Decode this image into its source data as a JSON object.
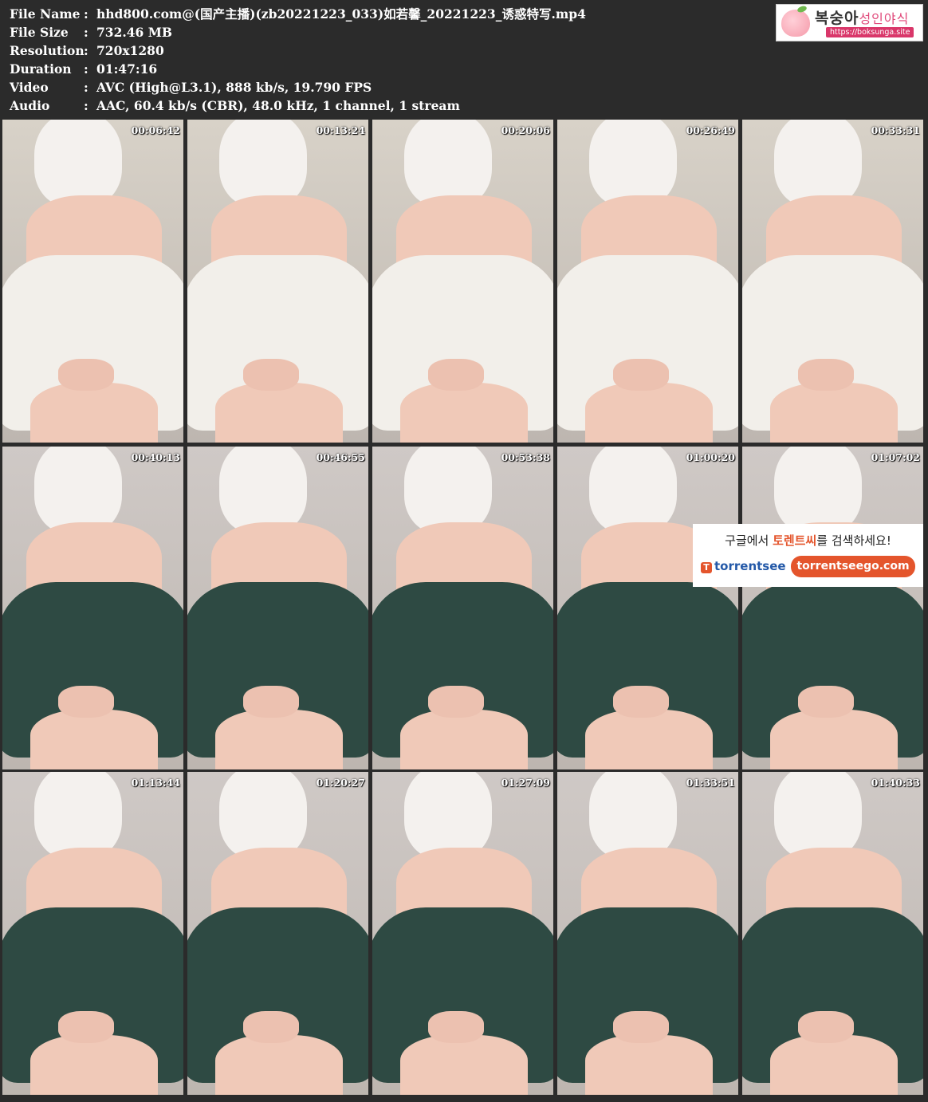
{
  "info": {
    "rows": [
      {
        "key": "File Name",
        "colon": ":",
        "value": "hhd800.com@(国产主播)(zb20221223_033)如若馨_20221223_诱惑特写.mp4"
      },
      {
        "key": "File Size",
        "colon": ":",
        "value": "732.46 MB"
      },
      {
        "key": "Resolution",
        "colon": ":",
        "value": "720x1280"
      },
      {
        "key": "Duration",
        "colon": ":",
        "value": "01:47:16"
      },
      {
        "key": "Video",
        "colon": ":",
        "value": "AVC (High@L3.1), 888 kb/s, 19.790 FPS"
      },
      {
        "key": "Audio",
        "colon": ":",
        "value": "AAC, 60.4 kb/s (CBR), 48.0 kHz, 1 channel, 1 stream"
      }
    ]
  },
  "logo": {
    "brand": "복숭아",
    "brand_sub": "성인야식",
    "url": "https://boksunga.site"
  },
  "thumbnails": [
    {
      "time": "00:06:42",
      "outfit": "white"
    },
    {
      "time": "00:13:24",
      "outfit": "white"
    },
    {
      "time": "00:20:06",
      "outfit": "white"
    },
    {
      "time": "00:26:49",
      "outfit": "white"
    },
    {
      "time": "00:33:31",
      "outfit": "white"
    },
    {
      "time": "00:40:13",
      "outfit": "green"
    },
    {
      "time": "00:46:55",
      "outfit": "green"
    },
    {
      "time": "00:53:38",
      "outfit": "green"
    },
    {
      "time": "01:00:20",
      "outfit": "green"
    },
    {
      "time": "01:07:02",
      "outfit": "green"
    },
    {
      "time": "01:13:44",
      "outfit": "green"
    },
    {
      "time": "01:20:27",
      "outfit": "green"
    },
    {
      "time": "01:27:09",
      "outfit": "green"
    },
    {
      "time": "01:33:51",
      "outfit": "green"
    },
    {
      "time": "01:40:33",
      "outfit": "green"
    }
  ],
  "ad": {
    "line1_pre": "구글에서 ",
    "line1_hl": "토렌트씨",
    "line1_post": "를 검색하세요!",
    "badge_icon": "T",
    "badge_text": "torrentsee",
    "button": "torrentseego.com"
  },
  "colors": {
    "background": "#2b2b2b",
    "white_outfit": "#f2efea",
    "green_outfit": "#2e4a43",
    "skin": "#f0c9b8",
    "ad_accent": "#e4552c"
  }
}
